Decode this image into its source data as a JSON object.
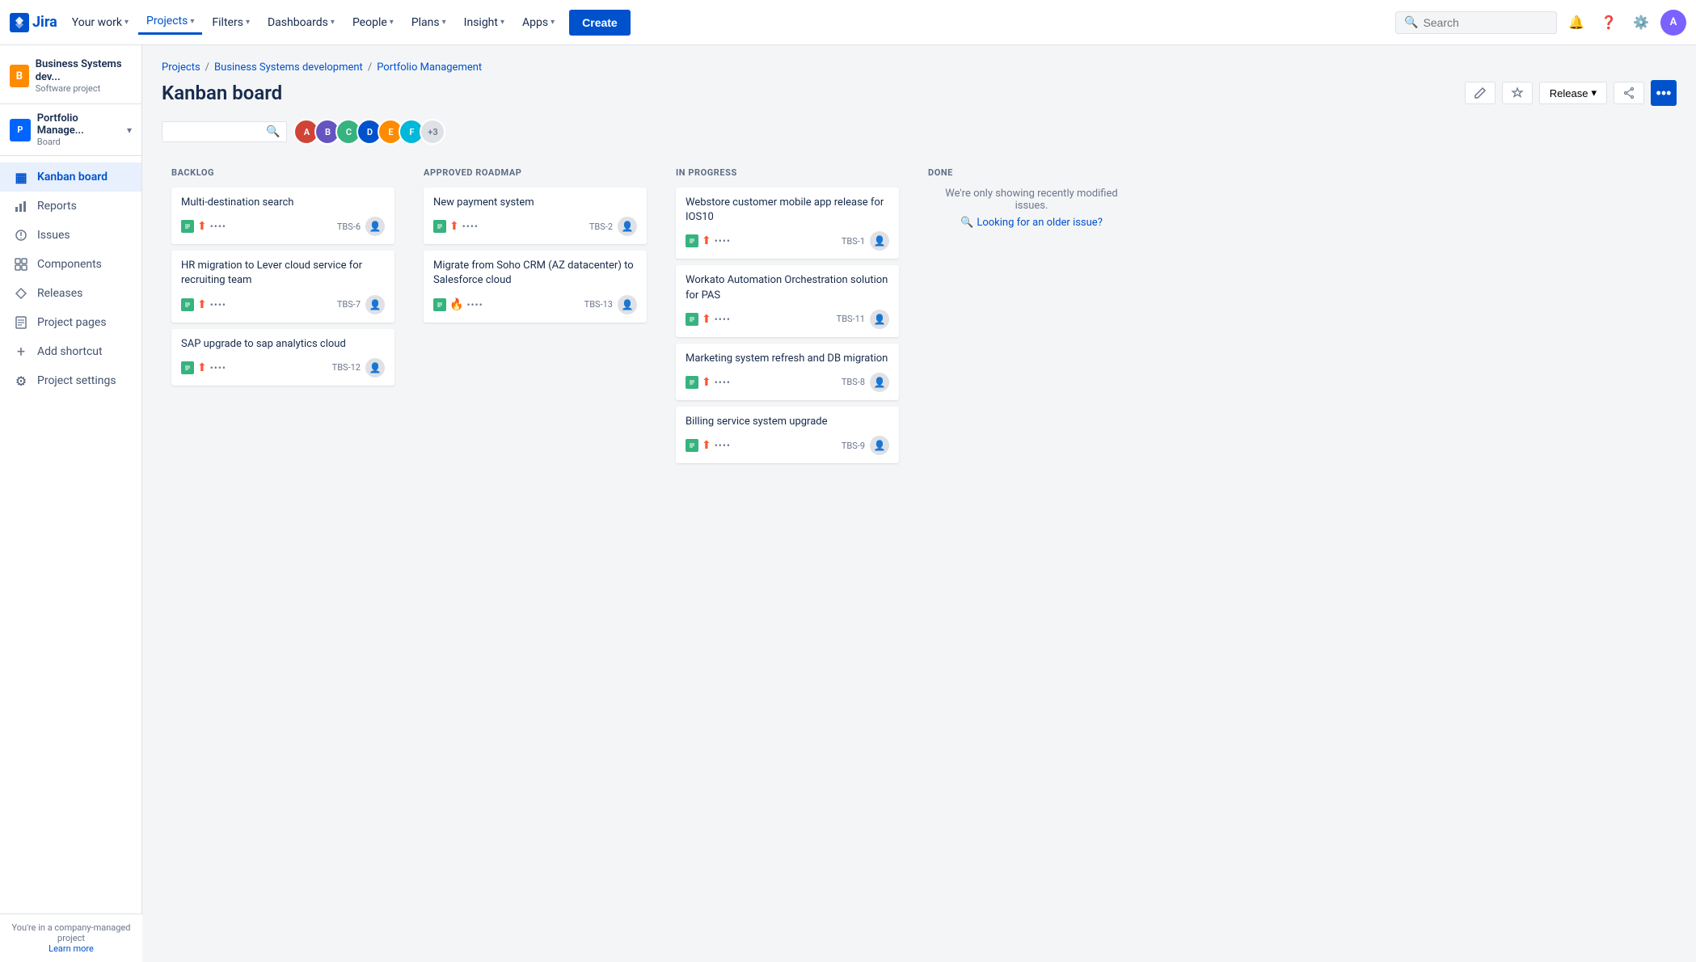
{
  "topNav": {
    "logo": "Jira",
    "items": [
      {
        "label": "Your work",
        "hasDropdown": true
      },
      {
        "label": "Projects",
        "hasDropdown": true,
        "active": true
      },
      {
        "label": "Filters",
        "hasDropdown": true
      },
      {
        "label": "Dashboards",
        "hasDropdown": true
      },
      {
        "label": "People",
        "hasDropdown": true
      },
      {
        "label": "Plans",
        "hasDropdown": true
      },
      {
        "label": "Insight",
        "hasDropdown": true
      },
      {
        "label": "Apps",
        "hasDropdown": true
      }
    ],
    "createBtn": "Create",
    "searchPlaceholder": "Search",
    "userInitial": "A"
  },
  "sidebar": {
    "project1": {
      "icon": "B",
      "title": "Business Systems dev...",
      "subtitle": "Software project"
    },
    "project2": {
      "icon": "P",
      "title": "Portfolio Manage...",
      "subtitle": "Board"
    },
    "navItems": [
      {
        "label": "Kanban board",
        "icon": "▦",
        "active": true
      },
      {
        "label": "Reports",
        "icon": "📊"
      },
      {
        "label": "Issues",
        "icon": "⚠"
      },
      {
        "label": "Components",
        "icon": "⊞"
      },
      {
        "label": "Releases",
        "icon": "🚀"
      },
      {
        "label": "Project pages",
        "icon": "📄"
      },
      {
        "label": "Add shortcut",
        "icon": "+"
      },
      {
        "label": "Project settings",
        "icon": "⚙"
      }
    ],
    "footer": {
      "message": "You're in a company-managed project",
      "linkLabel": "Learn more"
    }
  },
  "breadcrumb": {
    "items": [
      {
        "label": "Projects",
        "href": "#"
      },
      {
        "label": "Business Systems development",
        "href": "#"
      },
      {
        "label": "Portfolio Management",
        "href": "#"
      }
    ]
  },
  "pageTitle": "Kanban board",
  "pageActions": {
    "releaseBtn": "Release",
    "dotsTooltip": "More"
  },
  "boardToolbar": {
    "searchPlaceholder": "",
    "avatars": [
      {
        "color": "#d04437",
        "initial": "A"
      },
      {
        "color": "#6554c0",
        "initial": "B"
      },
      {
        "color": "#36b37e",
        "initial": "C"
      },
      {
        "color": "#0052cc",
        "initial": "D"
      },
      {
        "color": "#ff8b00",
        "initial": "E"
      },
      {
        "color": "#00b8d9",
        "initial": "F"
      }
    ],
    "extraCount": "+3"
  },
  "columns": [
    {
      "id": "backlog",
      "label": "BACKLOG",
      "cards": [
        {
          "id": "TBS-6",
          "title": "Multi-destination search",
          "iconType": "story",
          "iconLabel": "S",
          "priority": "high",
          "priorityIcon": "⬆",
          "assignedColor": "#6b778c",
          "assignedInitial": "?"
        },
        {
          "id": "TBS-7",
          "title": "HR migration to Lever cloud service for recruiting team",
          "iconType": "story",
          "iconLabel": "S",
          "priority": "high",
          "priorityIcon": "⬆",
          "assignedColor": "#6b778c",
          "assignedInitial": "?"
        },
        {
          "id": "TBS-12",
          "title": "SAP upgrade to sap analytics cloud",
          "iconType": "story",
          "iconLabel": "S",
          "priority": "high",
          "priorityIcon": "⬆",
          "assignedColor": "#6b778c",
          "assignedInitial": "?"
        }
      ]
    },
    {
      "id": "approved-roadmap",
      "label": "APPROVED ROADMAP",
      "cards": [
        {
          "id": "TBS-2",
          "title": "New payment system",
          "iconType": "story",
          "iconLabel": "S",
          "priority": "high",
          "priorityIcon": "⬆",
          "assignedColor": "#6b778c",
          "assignedInitial": "?"
        },
        {
          "id": "TBS-13",
          "title": "Migrate from Soho CRM (AZ datacenter) to Salesforce cloud",
          "iconType": "story",
          "iconLabel": "S",
          "priority": "critical",
          "priorityIcon": "🔥",
          "assignedColor": "#6b778c",
          "assignedInitial": "?"
        }
      ]
    },
    {
      "id": "in-progress",
      "label": "IN PROGRESS",
      "cards": [
        {
          "id": "TBS-1",
          "title": "Webstore customer mobile app release for IOS10",
          "iconType": "story",
          "iconLabel": "S",
          "priority": "high",
          "priorityIcon": "⬆",
          "assignedColor": "#6b778c",
          "assignedInitial": "?"
        },
        {
          "id": "TBS-11",
          "title": "Workato Automation Orchestration solution for PAS",
          "iconType": "story",
          "iconLabel": "S",
          "priority": "high",
          "priorityIcon": "⬆",
          "assignedColor": "#6b778c",
          "assignedInitial": "?"
        },
        {
          "id": "TBS-8",
          "title": "Marketing system refresh and DB migration",
          "iconType": "story",
          "iconLabel": "S",
          "priority": "high",
          "priorityIcon": "⬆",
          "assignedColor": "#6b778c",
          "assignedInitial": "?"
        },
        {
          "id": "TBS-9",
          "title": "Billing service system upgrade",
          "iconType": "story",
          "iconLabel": "S",
          "priority": "high",
          "priorityIcon": "⬆",
          "assignedColor": "#6b778c",
          "assignedInitial": "?"
        }
      ]
    },
    {
      "id": "done",
      "label": "DONE",
      "isDone": true,
      "doneMessage": "We're only showing recently modified issues.",
      "doneLink": "Looking for an older issue?"
    }
  ]
}
